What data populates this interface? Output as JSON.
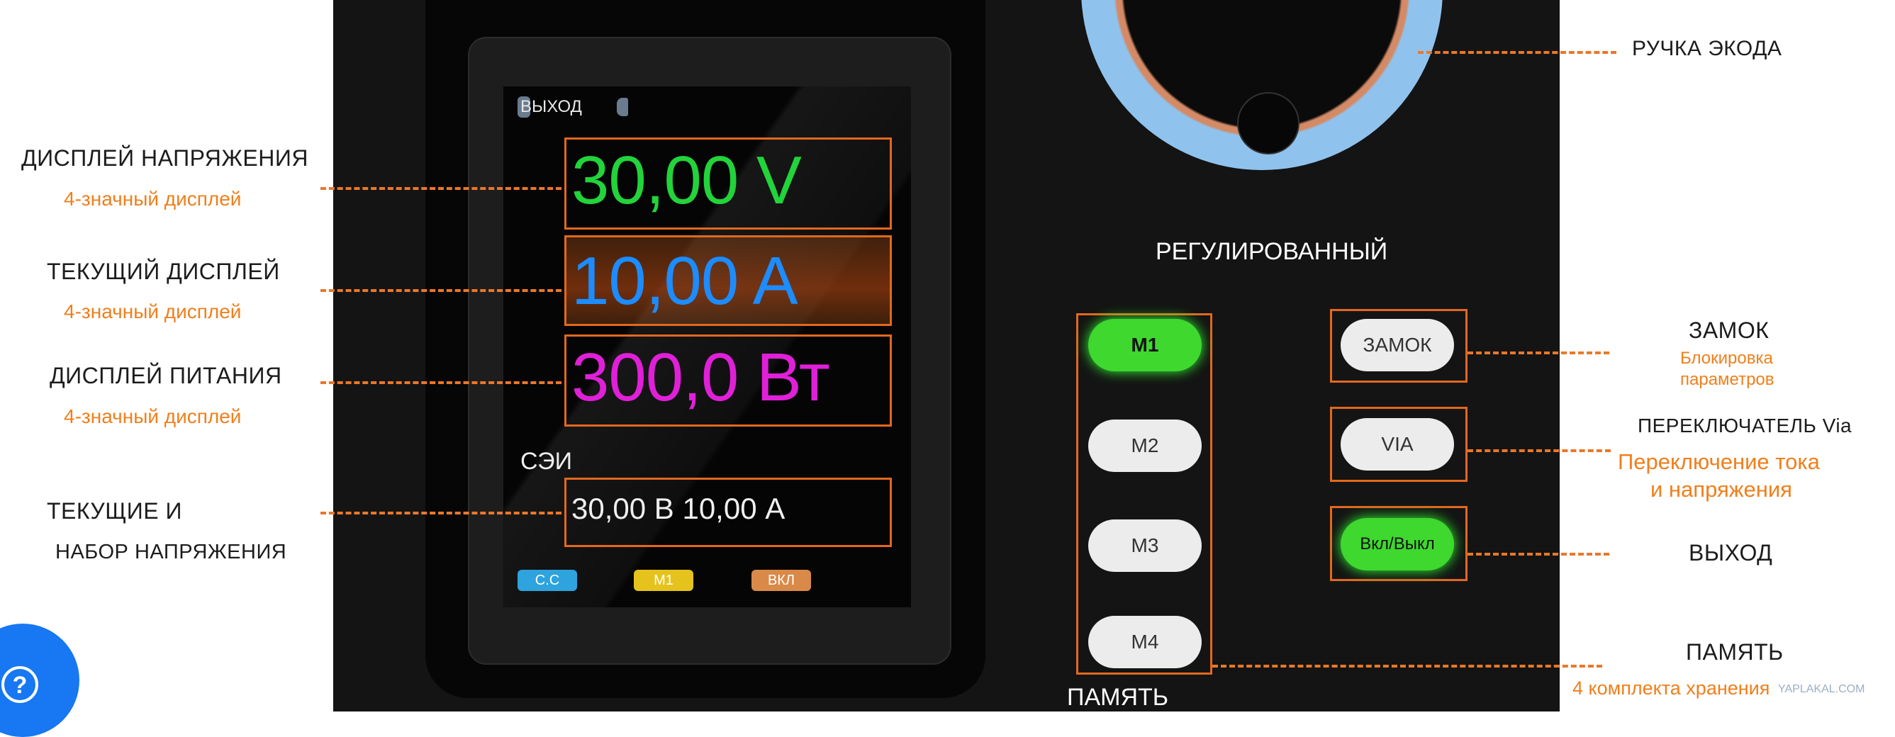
{
  "left_labels": {
    "voltage_display": {
      "title": "ДИСПЛЕЙ НАПРЯЖЕНИЯ",
      "note": "4-значный дисплей"
    },
    "current_display": {
      "title": "ТЕКУЩИЙ ДИСПЛЕЙ",
      "note": "4-значный дисплей"
    },
    "power_display": {
      "title": "ДИСПЛЕЙ ПИТАНИЯ",
      "note": "4-значный дисплей"
    },
    "set_values": {
      "title_line1": "ТЕКУЩИЕ И",
      "title_line2": "НАБОР НАПРЯЖЕНИЯ"
    }
  },
  "screen": {
    "output_label": "ВЫХОД",
    "voltage": "30,00 V",
    "current": "10,00 A",
    "power": "300,0 Вт",
    "set_label": "СЭИ",
    "set_values": "30,00 В 10,00 А",
    "status_tags": [
      {
        "text": "C.C",
        "color": "#2ea3dd"
      },
      {
        "text": "M1",
        "color": "#e6c21c"
      },
      {
        "text": "ВКЛ",
        "color": "#d98a48"
      }
    ],
    "colors": {
      "voltage": "#22d33a",
      "current": "#1c8cff",
      "power": "#e020d8"
    }
  },
  "panel": {
    "regulated_label": "РЕГУЛИРОВАННЫЙ",
    "memory_buttons": [
      "M1",
      "M2",
      "M3",
      "M4"
    ],
    "memory_label": "ПАМЯТЬ",
    "lock_button": "ЗАМОК",
    "via_button": "VIA",
    "output_button": "Вкл/Выкл"
  },
  "right_labels": {
    "encoder": {
      "title": "РУЧКА ЭКОДА"
    },
    "lock": {
      "title": "ЗАМОК",
      "note_line1": "Блокировка",
      "note_line2": "параметров"
    },
    "via_switch": {
      "title": "ПЕРЕКЛЮЧАТЕЛЬ Via",
      "note_line1": "Переключение тока",
      "note_line2": "и напряжения"
    },
    "output": {
      "title": "ВЫХОД"
    },
    "memory": {
      "title": "ПАМЯТЬ",
      "note": "4 комплекта хранения"
    },
    "watermark": "YAPLAKAL.COM"
  },
  "help_button": {
    "icon": "question-icon",
    "color": "#1877f2"
  },
  "accent_color": "#e8782a"
}
